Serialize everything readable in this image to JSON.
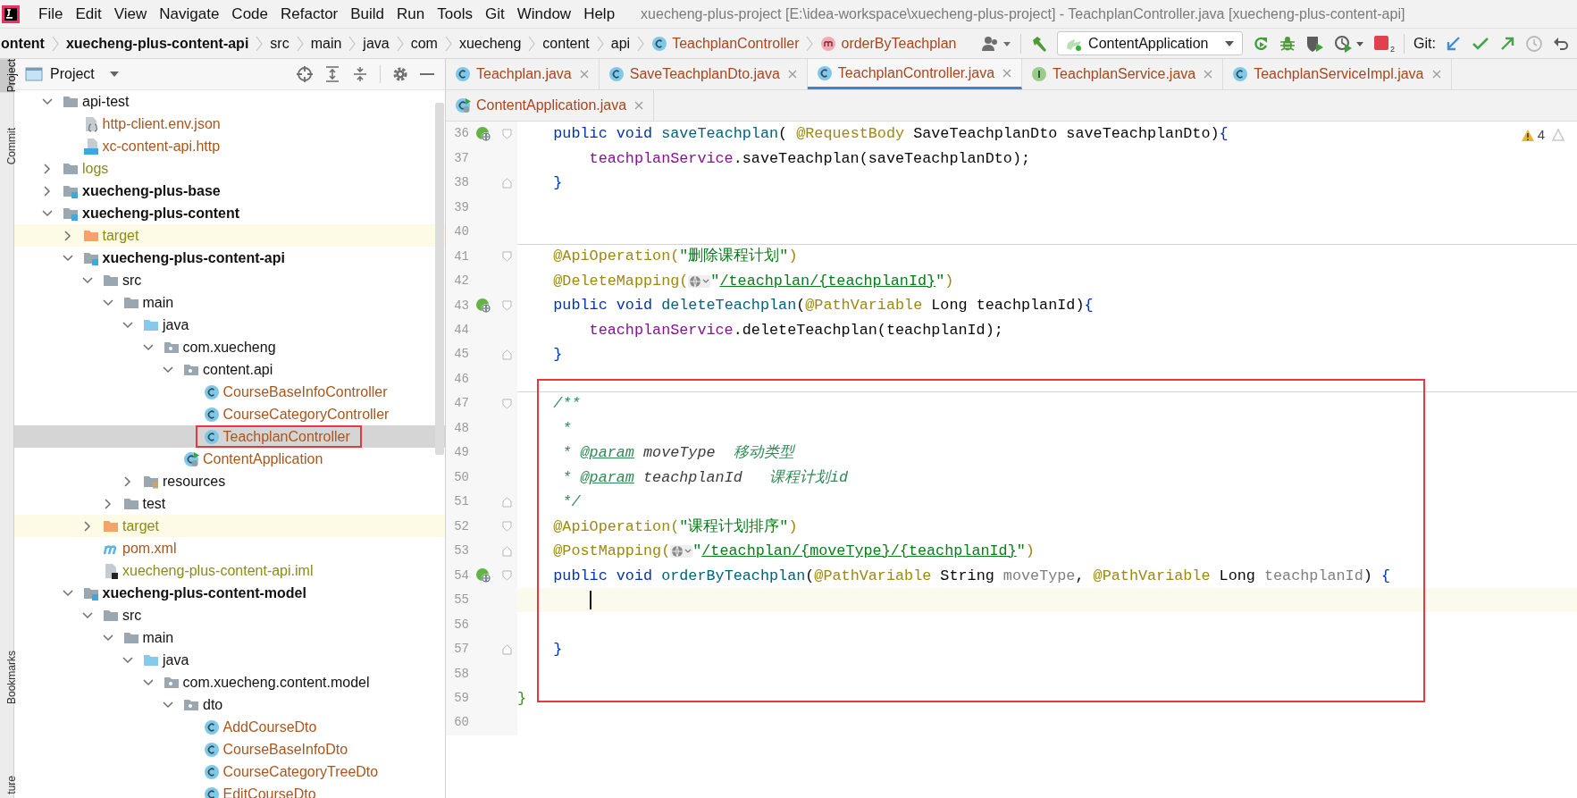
{
  "menu": [
    {
      "label": "File"
    },
    {
      "label": "Edit"
    },
    {
      "label": "View"
    },
    {
      "label": "Navigate"
    },
    {
      "label": "Code"
    },
    {
      "label": "Refactor"
    },
    {
      "label": "Build"
    },
    {
      "label": "Run"
    },
    {
      "label": "Tools"
    },
    {
      "label": "Git"
    },
    {
      "label": "Window"
    },
    {
      "label": "Help"
    }
  ],
  "window": {
    "title": "xuecheng-plus-project [E:\\idea-workspace\\xuecheng-plus-project] - TeachplanController.java [xuecheng-plus-content-api]"
  },
  "breadcrumbs": [
    {
      "label": "ontent",
      "bold": true
    },
    {
      "label": "xuecheng-plus-content-api",
      "bold": true
    },
    {
      "label": "src"
    },
    {
      "label": "main"
    },
    {
      "label": "java"
    },
    {
      "label": "com"
    },
    {
      "label": "xuecheng"
    },
    {
      "label": "content"
    },
    {
      "label": "api"
    },
    {
      "label": "TeachplanController",
      "kind": "class"
    },
    {
      "label": "orderByTeachplan",
      "kind": "method"
    }
  ],
  "toolbar": {
    "run_config": "ContentApplication",
    "stop_count": "2",
    "git_label": "Git:"
  },
  "tool_windows_top": [
    {
      "label": "Project",
      "selected": true
    },
    {
      "label": "Commit",
      "selected": false
    }
  ],
  "tool_windows_bottom": [
    {
      "label": "Bookmarks",
      "selected": false
    },
    {
      "label": "ture",
      "selected": false
    }
  ],
  "project_panel": {
    "title": "Project",
    "tree": [
      {
        "label": "api-test",
        "kind": "folder",
        "expanded": true,
        "selected": false,
        "children": [
          {
            "label": "http-client.env.json",
            "kind": "json",
            "color": "#a8561d",
            "selected": false
          },
          {
            "label": "xc-content-api.http",
            "kind": "http",
            "color": "#a8561d",
            "selected": false
          }
        ]
      },
      {
        "label": "logs",
        "kind": "folder",
        "color": "#8b8b16",
        "expanded": false,
        "selected": false
      },
      {
        "label": "xuecheng-plus-base",
        "kind": "module",
        "expanded": false,
        "selected": false
      },
      {
        "label": "xuecheng-plus-content",
        "kind": "module",
        "expanded": true,
        "selected": false,
        "children": [
          {
            "label": "target",
            "kind": "excluded",
            "color": "#8b8b16",
            "expanded": false,
            "selected": false
          },
          {
            "label": "xuecheng-plus-content-api",
            "kind": "module",
            "expanded": true,
            "selected": false,
            "children": [
              {
                "label": "src",
                "kind": "folder",
                "expanded": true,
                "selected": false,
                "children": [
                  {
                    "label": "main",
                    "kind": "folder",
                    "expanded": true,
                    "selected": false,
                    "children": [
                      {
                        "label": "java",
                        "kind": "sources",
                        "expanded": true,
                        "selected": false,
                        "children": [
                          {
                            "label": "com.xuecheng",
                            "kind": "package",
                            "expanded": true,
                            "selected": false,
                            "children": [
                              {
                                "label": "content.api",
                                "kind": "package",
                                "expanded": true,
                                "selected": false,
                                "children": [
                                  {
                                    "label": "CourseBaseInfoController",
                                    "kind": "class",
                                    "color": "#a8561d",
                                    "selected": false
                                  },
                                  {
                                    "label": "CourseCategoryController",
                                    "kind": "class",
                                    "color": "#a8561d",
                                    "selected": false
                                  },
                                  {
                                    "label": "TeachplanController",
                                    "kind": "class",
                                    "color": "#a8561d",
                                    "selected": true,
                                    "framed": true
                                  }
                                ]
                              },
                              {
                                "label": "ContentApplication",
                                "kind": "app",
                                "color": "#a8561d",
                                "selected": false
                              }
                            ]
                          }
                        ]
                      },
                      {
                        "label": "resources",
                        "kind": "resources",
                        "expanded": false,
                        "selected": false
                      }
                    ]
                  },
                  {
                    "label": "test",
                    "kind": "folder",
                    "expanded": false,
                    "selected": false
                  }
                ]
              },
              {
                "label": "target",
                "kind": "excluded",
                "color": "#8b8b16",
                "expanded": false,
                "selected": false
              },
              {
                "label": "pom.xml",
                "kind": "maven",
                "color": "#a8561d",
                "selected": false
              },
              {
                "label": "xuecheng-plus-content-api.iml",
                "kind": "iml",
                "color": "#8b8b16",
                "selected": false
              }
            ]
          },
          {
            "label": "xuecheng-plus-content-model",
            "kind": "module",
            "expanded": true,
            "selected": false,
            "children": [
              {
                "label": "src",
                "kind": "folder",
                "expanded": true,
                "selected": false,
                "children": [
                  {
                    "label": "main",
                    "kind": "folder",
                    "expanded": true,
                    "selected": false,
                    "children": [
                      {
                        "label": "java",
                        "kind": "sources",
                        "expanded": true,
                        "selected": false,
                        "children": [
                          {
                            "label": "com.xuecheng.content.model",
                            "kind": "package",
                            "expanded": true,
                            "selected": false,
                            "children": [
                              {
                                "label": "dto",
                                "kind": "package",
                                "expanded": true,
                                "selected": false,
                                "children": [
                                  {
                                    "label": "AddCourseDto",
                                    "kind": "class",
                                    "color": "#a8561d",
                                    "selected": false
                                  },
                                  {
                                    "label": "CourseBaseInfoDto",
                                    "kind": "class",
                                    "color": "#a8561d",
                                    "selected": false
                                  },
                                  {
                                    "label": "CourseCategoryTreeDto",
                                    "kind": "class",
                                    "color": "#a8561d",
                                    "selected": false
                                  },
                                  {
                                    "label": "EditCourseDto",
                                    "kind": "class",
                                    "color": "#a8561d",
                                    "selected": false
                                  }
                                ]
                              }
                            ]
                          }
                        ]
                      }
                    ]
                  }
                ]
              }
            ]
          }
        ]
      }
    ]
  },
  "editor": {
    "tab_rows": [
      [
        {
          "label": "Teachplan.java",
          "kind": "class",
          "selected": false
        },
        {
          "label": "SaveTeachplanDto.java",
          "kind": "class",
          "selected": false
        },
        {
          "label": "TeachplanController.java",
          "kind": "class",
          "selected": true
        },
        {
          "label": "TeachplanService.java",
          "kind": "interface",
          "selected": false
        },
        {
          "label": "TeachplanServiceImpl.java",
          "kind": "class",
          "selected": false
        }
      ],
      [
        {
          "label": "ContentApplication.java",
          "kind": "app",
          "selected": false
        }
      ]
    ],
    "warnings": "4",
    "blocks": [
      {
        "framed": false,
        "lines": [
          {
            "number": "36",
            "fold_start": true,
            "mapping_icon": true,
            "tokens": [
              {
                "kind": "kw",
                "text": "    public void "
              },
              {
                "kind": "fn",
                "text": "saveTeachplan"
              },
              {
                "kind": "txt",
                "text": "( "
              },
              {
                "kind": "ann",
                "text": "@RequestBody"
              },
              {
                "kind": "txt",
                "text": " SaveTeachplanDto saveTeachplanDto)"
              },
              {
                "kind": "brace",
                "text": "{"
              }
            ]
          },
          {
            "number": "37",
            "tokens": [
              {
                "kind": "field",
                "text": "        teachplanService"
              },
              {
                "kind": "txt",
                "text": ".saveTeachplan(saveTeachplanDto);"
              }
            ]
          },
          {
            "number": "38",
            "fold_end": true,
            "tokens": [
              {
                "kind": "brace",
                "text": "    }"
              }
            ]
          },
          {
            "number": "39"
          },
          {
            "number": "40"
          },
          {
            "number": "41",
            "fold_start": true,
            "separator_above": true,
            "tokens": [
              {
                "kind": "ann",
                "text": "    @ApiOperation("
              },
              {
                "kind": "str",
                "text": "\"删除课程计划\""
              },
              {
                "kind": "ann",
                "text": ")"
              }
            ]
          },
          {
            "number": "42",
            "tokens": [
              {
                "kind": "ann",
                "text": "    @DeleteMapping("
              },
              {
                "kind": "inlay"
              },
              {
                "kind": "str",
                "text": "\""
              },
              {
                "kind": "url",
                "text": "/teachplan/{teachplanId}"
              },
              {
                "kind": "str",
                "text": "\""
              },
              {
                "kind": "ann",
                "text": ")"
              }
            ]
          },
          {
            "number": "43",
            "fold_start": true,
            "mapping_icon": true,
            "tokens": [
              {
                "kind": "kw",
                "text": "    public void "
              },
              {
                "kind": "fn",
                "text": "deleteTeachplan"
              },
              {
                "kind": "txt",
                "text": "("
              },
              {
                "kind": "ann",
                "text": "@PathVariable"
              },
              {
                "kind": "txt",
                "text": " Long teachplanId)"
              },
              {
                "kind": "brace",
                "text": "{"
              }
            ]
          },
          {
            "number": "44",
            "tokens": [
              {
                "kind": "field",
                "text": "        teachplanService"
              },
              {
                "kind": "txt",
                "text": ".deleteTeachplan(teachplanId);"
              }
            ]
          },
          {
            "number": "45",
            "fold_end": true,
            "tokens": [
              {
                "kind": "brace",
                "text": "    }"
              }
            ]
          },
          {
            "number": "46"
          }
        ]
      },
      {
        "framed": true,
        "lines": [
          {
            "number": "47",
            "fold_start": true,
            "separator_above": true,
            "tokens": [
              {
                "kind": "doc",
                "text": "    /**"
              }
            ]
          },
          {
            "number": "48",
            "tokens": [
              {
                "kind": "doc",
                "text": "     *"
              }
            ]
          },
          {
            "number": "49",
            "tokens": [
              {
                "kind": "doc",
                "text": "     * "
              },
              {
                "kind": "doctag",
                "text": "@param"
              },
              {
                "kind": "docparam",
                "text": " moveType"
              },
              {
                "kind": "doc",
                "text": "  移动类型"
              }
            ]
          },
          {
            "number": "50",
            "tokens": [
              {
                "kind": "doc",
                "text": "     * "
              },
              {
                "kind": "doctag",
                "text": "@param"
              },
              {
                "kind": "docparam",
                "text": " teachplanId"
              },
              {
                "kind": "doc",
                "text": "   课程计划id"
              }
            ]
          },
          {
            "number": "51",
            "fold_end": true,
            "tokens": [
              {
                "kind": "doc",
                "text": "     */"
              }
            ]
          },
          {
            "number": "52",
            "fold_start": true,
            "tokens": [
              {
                "kind": "ann",
                "text": "    @ApiOperation("
              },
              {
                "kind": "str",
                "text": "\"课程计划排序\""
              },
              {
                "kind": "ann",
                "text": ")"
              }
            ]
          },
          {
            "number": "53",
            "fold_end": true,
            "tokens": [
              {
                "kind": "ann",
                "text": "    @PostMapping("
              },
              {
                "kind": "inlay"
              },
              {
                "kind": "str",
                "text": "\""
              },
              {
                "kind": "url",
                "text": "/teachplan/{moveType}/{teachplanId}"
              },
              {
                "kind": "str",
                "text": "\""
              },
              {
                "kind": "ann",
                "text": ")"
              }
            ]
          },
          {
            "number": "54",
            "fold_start": true,
            "mapping_icon": true,
            "tokens": [
              {
                "kind": "kw",
                "text": "    public void "
              },
              {
                "kind": "fn",
                "text": "orderByTeachplan"
              },
              {
                "kind": "txt",
                "text": "("
              },
              {
                "kind": "ann",
                "text": "@PathVariable"
              },
              {
                "kind": "txt",
                "text": " String "
              },
              {
                "kind": "unused",
                "text": "moveType"
              },
              {
                "kind": "txt",
                "text": ", "
              },
              {
                "kind": "ann",
                "text": "@PathVariable"
              },
              {
                "kind": "txt",
                "text": " Long "
              },
              {
                "kind": "unused",
                "text": "teachplanId"
              },
              {
                "kind": "txt",
                "text": ") "
              },
              {
                "kind": "brace",
                "text": "{"
              }
            ]
          },
          {
            "number": "55",
            "current": true
          },
          {
            "number": "56"
          },
          {
            "number": "57",
            "fold_end": true,
            "tokens": [
              {
                "kind": "brace",
                "text": "    }"
              }
            ]
          },
          {
            "number": "58"
          },
          {
            "number": "59",
            "tokens": [
              {
                "kind": "brace2",
                "text": "}"
              }
            ]
          }
        ]
      },
      {
        "framed": false,
        "lines": [
          {
            "number": "60"
          }
        ]
      }
    ]
  }
}
